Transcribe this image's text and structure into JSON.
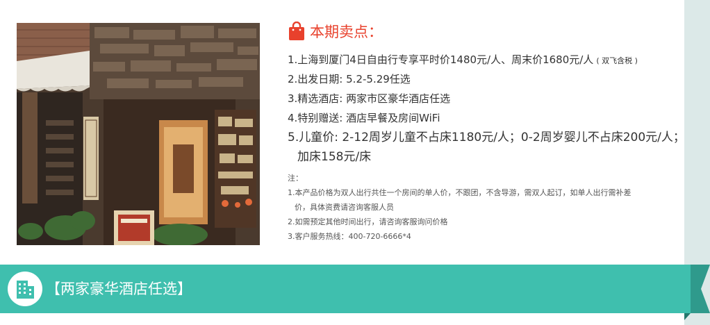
{
  "selling_points": {
    "icon": "shopping-bag-icon",
    "title": "本期卖点：",
    "items": [
      {
        "text": "1.上海到厦门4日自由行专享平时价1480元/人、周末价1680元/人",
        "note": "( 双飞含税 )"
      },
      {
        "text": "2.出发日期: 5.2-5.29任选"
      },
      {
        "text": "3.精选酒店: 两家市区豪华酒店任选"
      },
      {
        "text": "4.特别赠送: 酒店早餐及房间WiFi"
      },
      {
        "text": "5.儿童价: 2-12周岁儿童不占床1180元/人；0-2周岁婴儿不占床200元/人；",
        "cont": "加床158元/床"
      }
    ]
  },
  "notes": {
    "heading": "注：",
    "lines": [
      "1.本产品价格为双人出行共住一个房间的单人价，不跟团，不含导游，需双人起订，如单人出行需补差",
      "价，具体资费请咨询客服人员",
      "2.如需预定其他时间出行，请咨询客服询问价格",
      "3.客户服务热线：400-720-6666*4"
    ]
  },
  "banner": {
    "icon": "building-icon",
    "title": "【两家豪华酒店任选】",
    "color": "#3fbfae"
  },
  "colors": {
    "accent_red": "#e8412c",
    "teal": "#3fbfae",
    "side_strip": "#dce9e8"
  }
}
